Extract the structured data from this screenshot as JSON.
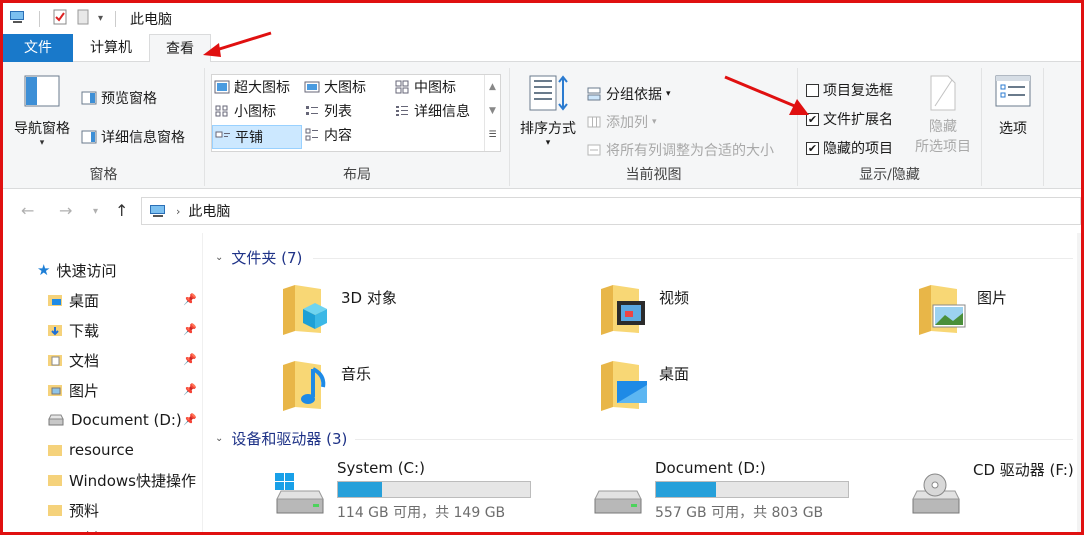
{
  "window": {
    "title": "此电脑"
  },
  "tabs": [
    {
      "label": "文件"
    },
    {
      "label": "计算机"
    },
    {
      "label": "查看"
    }
  ],
  "ribbon": {
    "pane": {
      "nav_pane": "导航窗格",
      "preview_pane": "预览窗格",
      "details_pane": "详细信息窗格",
      "group_label": "窗格"
    },
    "layout": {
      "extra_large": "超大图标",
      "large": "大图标",
      "medium": "中图标",
      "small": "小图标",
      "list": "列表",
      "details": "详细信息",
      "tiles": "平铺",
      "content": "内容",
      "group_label": "布局"
    },
    "current_view": {
      "sort_by": "排序方式",
      "group_by": "分组依据",
      "add_columns": "添加列",
      "size_all_columns": "将所有列调整为合适的大小",
      "group_label": "当前视图"
    },
    "show_hide": {
      "item_checkboxes": "项目复选框",
      "item_checkboxes_checked": false,
      "file_extensions": "文件扩展名",
      "file_extensions_checked": true,
      "hidden_items": "隐藏的项目",
      "hidden_items_checked": true,
      "hide_selected_line1": "隐藏",
      "hide_selected_line2": "所选项目",
      "group_label": "显示/隐藏"
    },
    "options": {
      "label": "选项"
    }
  },
  "address": {
    "path": "此电脑"
  },
  "navpane": {
    "items": [
      {
        "label": "快速访问"
      },
      {
        "label": "桌面"
      },
      {
        "label": "下载"
      },
      {
        "label": "文档"
      },
      {
        "label": "图片"
      },
      {
        "label": "Document (D:)"
      },
      {
        "label": "resource"
      },
      {
        "label": "Windows快捷操作"
      },
      {
        "label": "预料"
      },
      {
        "label": "预料"
      }
    ]
  },
  "content": {
    "folders_header": "文件夹 (7)",
    "folders": [
      {
        "label": "3D 对象"
      },
      {
        "label": "视频"
      },
      {
        "label": "图片"
      },
      {
        "label": "音乐"
      },
      {
        "label": "桌面"
      }
    ],
    "devices_header": "设备和驱动器 (3)",
    "drives": [
      {
        "name": "System (C:)",
        "free": "114 GB 可用，共 149 GB",
        "used_fraction": 0.23
      },
      {
        "name": "Document (D:)",
        "free": "557 GB 可用，共 803 GB",
        "used_fraction": 0.31
      },
      {
        "name": "CD 驱动器 (F:)"
      }
    ]
  },
  "colors": {
    "accent": "#1979ca",
    "annotation": "#e01010",
    "drive_bar": "#26a0da"
  }
}
